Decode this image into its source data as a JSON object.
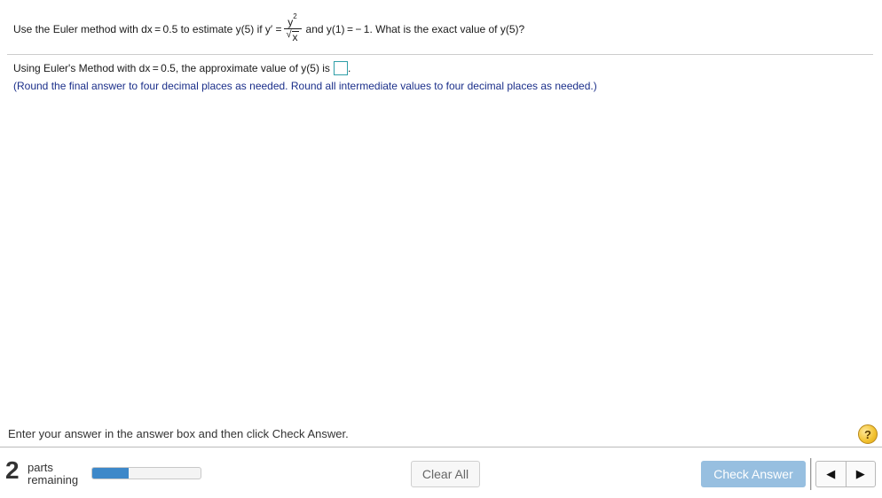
{
  "question": {
    "prefix": "Use the Euler method with dx = 0.5 to estimate y(5) if y′ =",
    "frac_numerator": "y",
    "frac_numerator_exp": "2",
    "frac_denominator_radical": "√",
    "frac_denominator": "x",
    "suffix": "and y(1) = − 1. What is the exact value of y(5)?"
  },
  "answer": {
    "lead": "Using Euler's Method with dx = 0.5, the approximate value of y(5) is",
    "trail": ".",
    "value": "",
    "instructions": "(Round the final answer to four decimal places as needed. Round all intermediate values to four decimal places as needed.)"
  },
  "footer": {
    "hint": "Enter your answer in the answer box and then click Check Answer.",
    "help_icon": "question-mark-icon",
    "help_glyph": "?"
  },
  "parts": {
    "count": "2",
    "label_line1": "parts",
    "label_line2": "remaining",
    "progress_fraction": 0.34
  },
  "buttons": {
    "clear_all": "Clear All",
    "check_answer": "Check Answer",
    "prev_icon": "triangle-left-icon",
    "next_icon": "triangle-right-icon",
    "prev_glyph": "◀",
    "next_glyph": "▶"
  },
  "colors": {
    "instruction_text": "#1b2f8a",
    "answer_box_border": "#2f9fa8",
    "check_button": "#97bfe0",
    "progress_fill": "#3d88c9",
    "help_icon": "#f2c12e"
  }
}
